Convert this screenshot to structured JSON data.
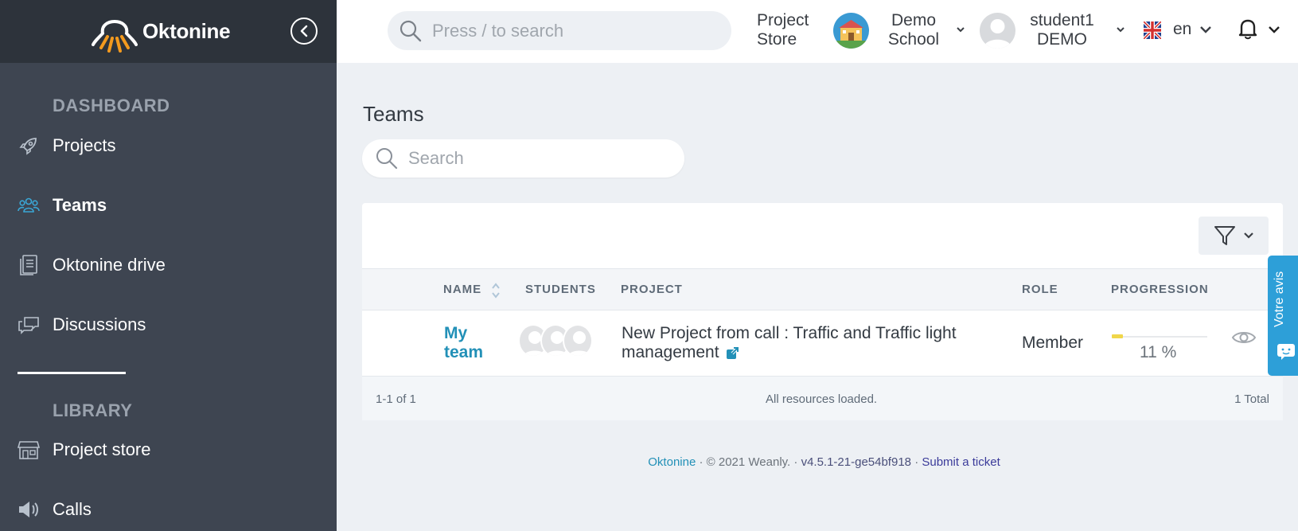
{
  "app": {
    "name": "Oktonine"
  },
  "sidebar": {
    "sections": [
      {
        "title": "DASHBOARD"
      },
      {
        "title": "LIBRARY"
      }
    ],
    "items": [
      {
        "label": "Projects",
        "icon": "rocket-icon"
      },
      {
        "label": "Teams",
        "icon": "team-icon"
      },
      {
        "label": "Oktonine drive",
        "icon": "drive-icon"
      },
      {
        "label": "Discussions",
        "icon": "discussions-icon"
      },
      {
        "label": "Project store",
        "icon": "store-icon"
      },
      {
        "label": "Calls",
        "icon": "megaphone-icon"
      }
    ],
    "active": "Teams"
  },
  "header": {
    "search_placeholder": "Press / to search",
    "project_store_line1": "Project",
    "project_store_line2": "Store",
    "school_line1": "Demo",
    "school_line2": "School",
    "user_line1": "student1",
    "user_line2": "DEMO",
    "language": "en"
  },
  "main": {
    "title": "Teams",
    "search_placeholder": "Search",
    "table": {
      "columns": [
        "NAME",
        "STUDENTS",
        "PROJECT",
        "ROLE",
        "PROGRESSION"
      ],
      "rows": [
        {
          "name_line1": "My",
          "name_line2": "team",
          "project_line1": "New Project from call : Traffic and Traffic light",
          "project_line2": "management",
          "role": "Member",
          "progression": 11,
          "progression_label": "11 %"
        }
      ],
      "range": "1-1 of 1",
      "status": "All resources loaded.",
      "total": "1 Total"
    }
  },
  "footer": {
    "brand": "Oktonine",
    "copyright": "© 2021 Weanly.",
    "version": "v4.5.1-21-ge54bf918",
    "ticket": "Submit a ticket"
  },
  "feedback_tab": "Votre avis",
  "colors": {
    "sidebar_bg": "#3e4551",
    "sidebar_top": "#2d333b",
    "accent": "#2290b7",
    "progress": "#f0d64a",
    "feedback": "#2d9fd8"
  }
}
